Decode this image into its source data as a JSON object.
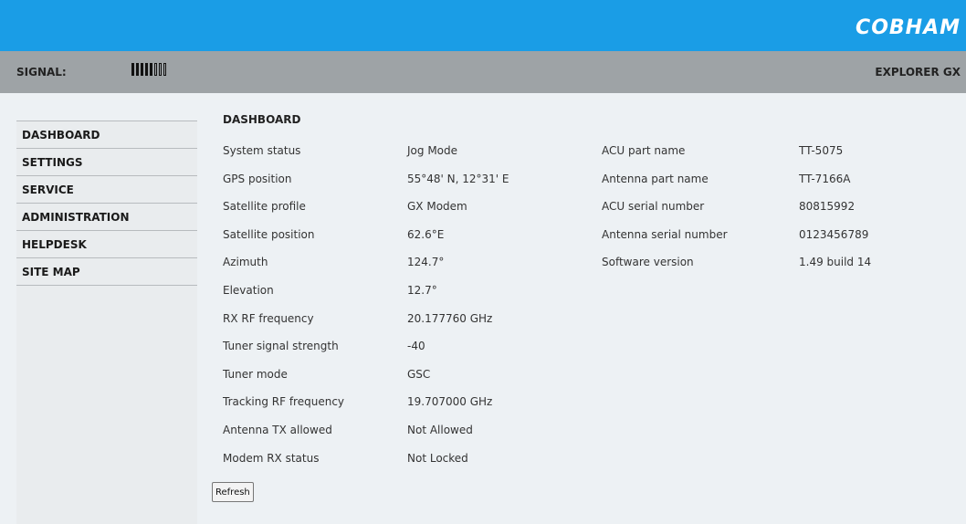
{
  "header": {
    "logo_text": "COBHAM",
    "signal_label": "SIGNAL:",
    "signal_level": {
      "filled": 5,
      "total": 8
    },
    "product_name": "EXPLORER GX"
  },
  "sidebar": {
    "items": [
      {
        "label": "DASHBOARD"
      },
      {
        "label": "SETTINGS"
      },
      {
        "label": "SERVICE"
      },
      {
        "label": "ADMINISTRATION"
      },
      {
        "label": "HELPDESK"
      },
      {
        "label": "SITE MAP"
      }
    ]
  },
  "dashboard": {
    "title": "DASHBOARD",
    "left": [
      {
        "label": "System status",
        "value": "Jog Mode"
      },
      {
        "label": "GPS position",
        "value": "55°48' N, 12°31' E"
      },
      {
        "label": "Satellite profile",
        "value": "GX Modem"
      },
      {
        "label": "Satellite position",
        "value": "62.6°E"
      },
      {
        "label": "Azimuth",
        "value": "124.7°"
      },
      {
        "label": "Elevation",
        "value": "12.7°"
      },
      {
        "label": "RX RF frequency",
        "value": "20.177760 GHz"
      },
      {
        "label": "Tuner signal strength",
        "value": "-40"
      },
      {
        "label": "Tuner mode",
        "value": "GSC"
      },
      {
        "label": "Tracking RF frequency",
        "value": "19.707000 GHz"
      },
      {
        "label": "Antenna TX allowed",
        "value": "Not Allowed"
      },
      {
        "label": "Modem RX status",
        "value": "Not Locked"
      }
    ],
    "right": [
      {
        "label": "ACU part name",
        "value": "TT-5075"
      },
      {
        "label": "Antenna part name",
        "value": "TT-7166A"
      },
      {
        "label": "ACU serial number",
        "value": "80815992"
      },
      {
        "label": "Antenna serial number",
        "value": "0123456789"
      },
      {
        "label": "Software version",
        "value": "1.49 build 14"
      }
    ],
    "refresh_label": "Refresh"
  }
}
